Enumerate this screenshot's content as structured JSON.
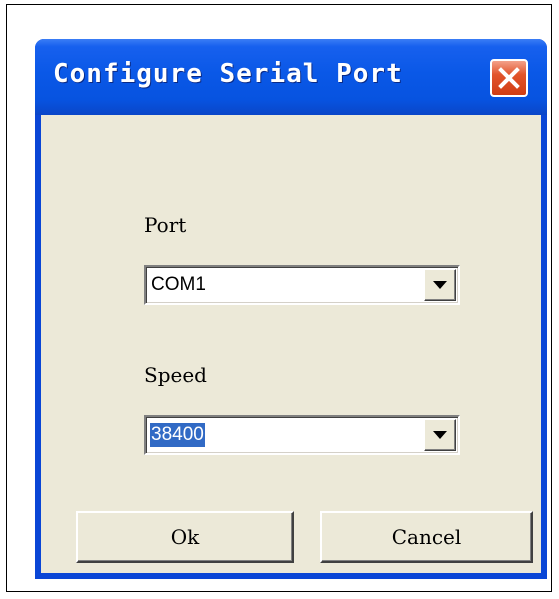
{
  "dialog": {
    "title": "Configure Serial Port",
    "close_icon": "close-icon",
    "title_bar_color": "#0a58e7",
    "client_bg_color": "#ece9d8"
  },
  "port": {
    "label": "Port",
    "value": "COM1",
    "arrow_icon": "dropdown-arrow-icon"
  },
  "speed": {
    "label": "Speed",
    "value": "38400",
    "selected": true,
    "arrow_icon": "dropdown-arrow-icon"
  },
  "buttons": {
    "ok_label": "Ok",
    "cancel_label": "Cancel"
  }
}
